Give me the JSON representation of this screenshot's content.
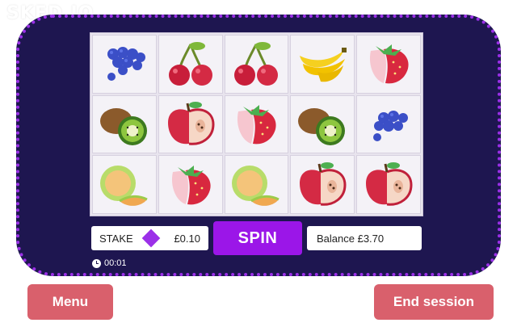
{
  "logo": {
    "text": "SKED.IO"
  },
  "reels": {
    "grid": [
      [
        "blueberries-icon",
        "cherries-icon",
        "cherries-icon",
        "banana-icon",
        "strawberry-icon"
      ],
      [
        "kiwi-icon",
        "apple-icon",
        "strawberry-icon",
        "kiwi-icon",
        "blueberries-icon"
      ],
      [
        "melon-icon",
        "strawberry-icon",
        "melon-icon",
        "apple-icon",
        "apple-icon"
      ]
    ]
  },
  "stake": {
    "label": "STAKE",
    "value": "£0.10"
  },
  "spin": {
    "label": "SPIN"
  },
  "balance": {
    "text": "Balance £3.70"
  },
  "timer": {
    "text": "00:01"
  },
  "buttons": {
    "menu": "Menu",
    "end_session": "End session"
  },
  "colors": {
    "machine_bg": "#1e1650",
    "accent_purple": "#9b16e8",
    "button_red": "#d9606c"
  }
}
